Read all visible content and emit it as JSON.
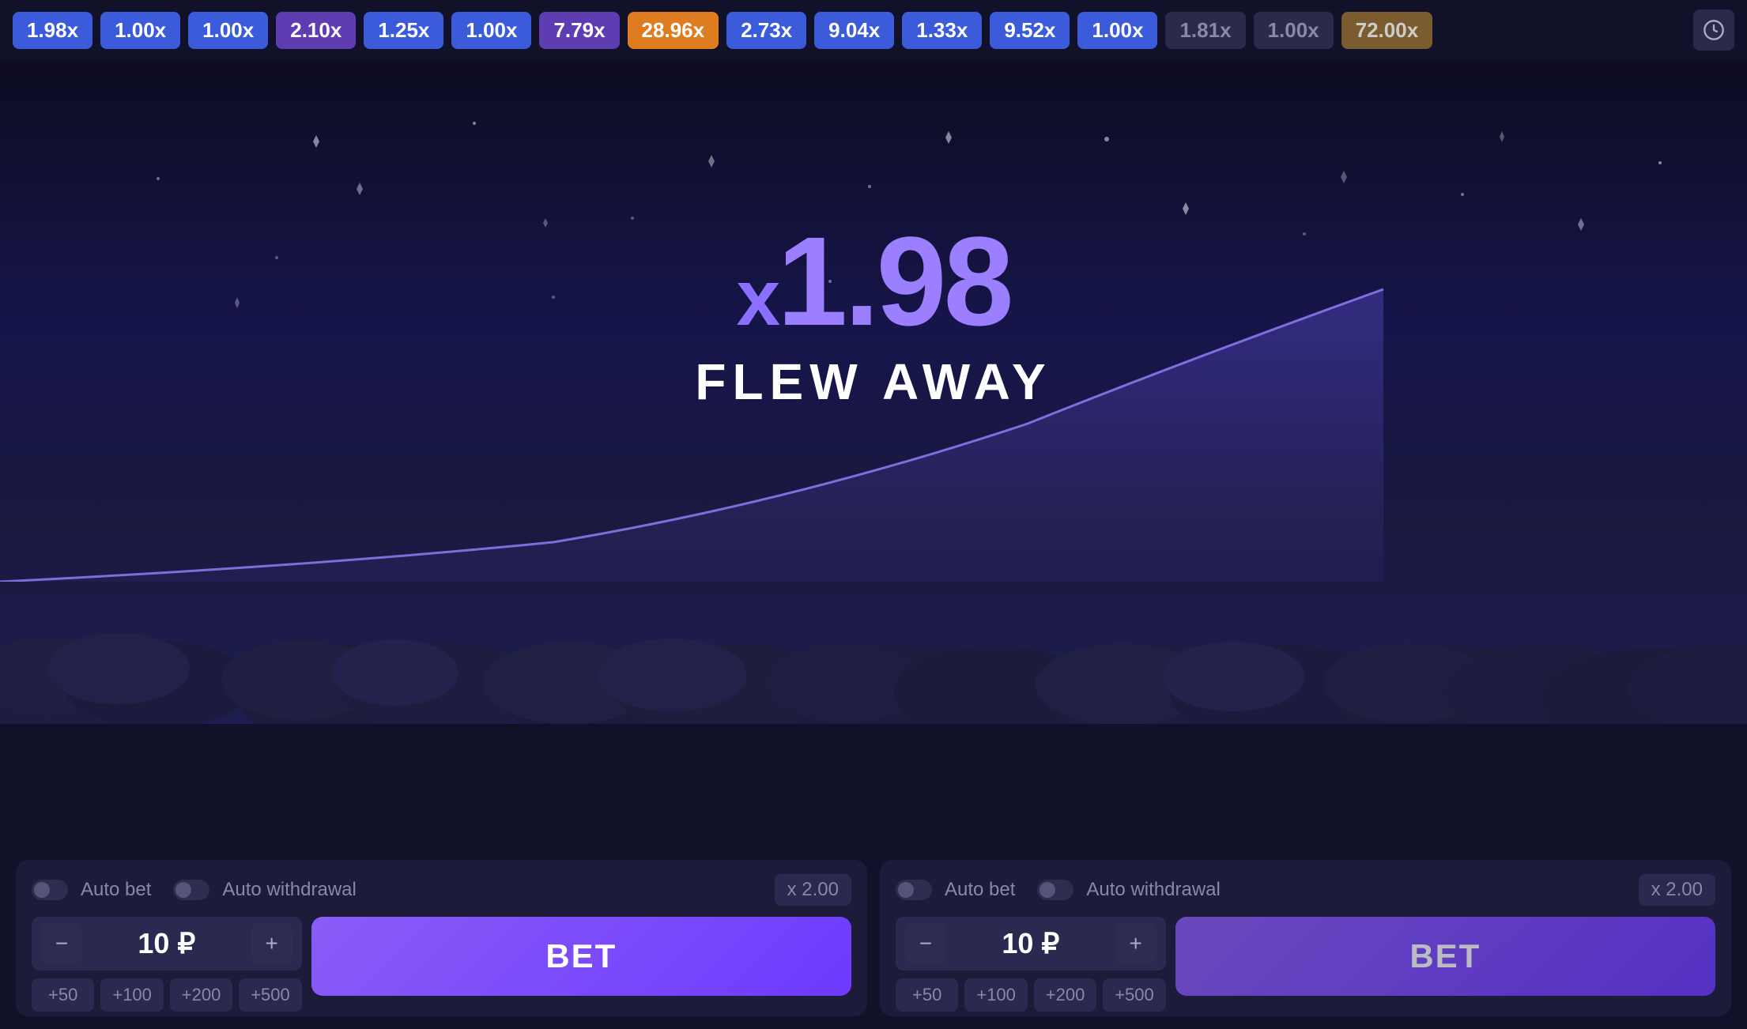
{
  "topbar": {
    "multipliers": [
      {
        "value": "1.98x",
        "style": "blue"
      },
      {
        "value": "1.00x",
        "style": "blue"
      },
      {
        "value": "1.00x",
        "style": "blue"
      },
      {
        "value": "2.10x",
        "style": "purple"
      },
      {
        "value": "1.25x",
        "style": "blue"
      },
      {
        "value": "1.00x",
        "style": "blue"
      },
      {
        "value": "7.79x",
        "style": "purple"
      },
      {
        "value": "28.96x",
        "style": "orange"
      },
      {
        "value": "2.73x",
        "style": "blue"
      },
      {
        "value": "9.04x",
        "style": "blue"
      },
      {
        "value": "1.33x",
        "style": "blue"
      },
      {
        "value": "9.52x",
        "style": "blue"
      },
      {
        "value": "1.00x",
        "style": "blue"
      },
      {
        "value": "1.81x",
        "style": "gray"
      },
      {
        "value": "1.00x",
        "style": "gray"
      },
      {
        "value": "72.00x",
        "style": "brown"
      }
    ],
    "clock_icon": "🕐"
  },
  "game": {
    "multiplier_prefix": "x",
    "multiplier_value": "1.98",
    "status_text": "FLEW AWAY"
  },
  "bet_panel_left": {
    "auto_bet_label": "Auto bet",
    "auto_withdrawal_label": "Auto withdrawal",
    "multiplier_value": "x 2.00",
    "bet_amount": "10 ₽",
    "quick_adds": [
      "+50",
      "+100",
      "+200",
      "+500"
    ],
    "bet_button_label": "BET"
  },
  "bet_panel_right": {
    "auto_bet_label": "Auto bet",
    "auto_withdrawal_label": "Auto withdrawal",
    "multiplier_value": "x 2.00",
    "bet_amount": "10 ₽",
    "quick_adds": [
      "+50",
      "+100",
      "+200",
      "+500"
    ],
    "bet_button_label": "BET"
  }
}
